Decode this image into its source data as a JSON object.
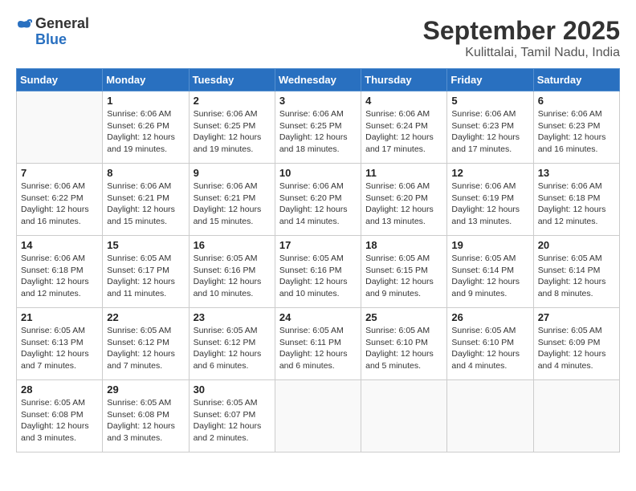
{
  "header": {
    "logo_line1": "General",
    "logo_line2": "Blue",
    "month_title": "September 2025",
    "subtitle": "Kulittalai, Tamil Nadu, India"
  },
  "days_of_week": [
    "Sunday",
    "Monday",
    "Tuesday",
    "Wednesday",
    "Thursday",
    "Friday",
    "Saturday"
  ],
  "weeks": [
    [
      {
        "day": "",
        "info": ""
      },
      {
        "day": "1",
        "info": "Sunrise: 6:06 AM\nSunset: 6:26 PM\nDaylight: 12 hours\nand 19 minutes."
      },
      {
        "day": "2",
        "info": "Sunrise: 6:06 AM\nSunset: 6:25 PM\nDaylight: 12 hours\nand 19 minutes."
      },
      {
        "day": "3",
        "info": "Sunrise: 6:06 AM\nSunset: 6:25 PM\nDaylight: 12 hours\nand 18 minutes."
      },
      {
        "day": "4",
        "info": "Sunrise: 6:06 AM\nSunset: 6:24 PM\nDaylight: 12 hours\nand 17 minutes."
      },
      {
        "day": "5",
        "info": "Sunrise: 6:06 AM\nSunset: 6:23 PM\nDaylight: 12 hours\nand 17 minutes."
      },
      {
        "day": "6",
        "info": "Sunrise: 6:06 AM\nSunset: 6:23 PM\nDaylight: 12 hours\nand 16 minutes."
      }
    ],
    [
      {
        "day": "7",
        "info": "Sunrise: 6:06 AM\nSunset: 6:22 PM\nDaylight: 12 hours\nand 16 minutes."
      },
      {
        "day": "8",
        "info": "Sunrise: 6:06 AM\nSunset: 6:21 PM\nDaylight: 12 hours\nand 15 minutes."
      },
      {
        "day": "9",
        "info": "Sunrise: 6:06 AM\nSunset: 6:21 PM\nDaylight: 12 hours\nand 15 minutes."
      },
      {
        "day": "10",
        "info": "Sunrise: 6:06 AM\nSunset: 6:20 PM\nDaylight: 12 hours\nand 14 minutes."
      },
      {
        "day": "11",
        "info": "Sunrise: 6:06 AM\nSunset: 6:20 PM\nDaylight: 12 hours\nand 13 minutes."
      },
      {
        "day": "12",
        "info": "Sunrise: 6:06 AM\nSunset: 6:19 PM\nDaylight: 12 hours\nand 13 minutes."
      },
      {
        "day": "13",
        "info": "Sunrise: 6:06 AM\nSunset: 6:18 PM\nDaylight: 12 hours\nand 12 minutes."
      }
    ],
    [
      {
        "day": "14",
        "info": "Sunrise: 6:06 AM\nSunset: 6:18 PM\nDaylight: 12 hours\nand 12 minutes."
      },
      {
        "day": "15",
        "info": "Sunrise: 6:05 AM\nSunset: 6:17 PM\nDaylight: 12 hours\nand 11 minutes."
      },
      {
        "day": "16",
        "info": "Sunrise: 6:05 AM\nSunset: 6:16 PM\nDaylight: 12 hours\nand 10 minutes."
      },
      {
        "day": "17",
        "info": "Sunrise: 6:05 AM\nSunset: 6:16 PM\nDaylight: 12 hours\nand 10 minutes."
      },
      {
        "day": "18",
        "info": "Sunrise: 6:05 AM\nSunset: 6:15 PM\nDaylight: 12 hours\nand 9 minutes."
      },
      {
        "day": "19",
        "info": "Sunrise: 6:05 AM\nSunset: 6:14 PM\nDaylight: 12 hours\nand 9 minutes."
      },
      {
        "day": "20",
        "info": "Sunrise: 6:05 AM\nSunset: 6:14 PM\nDaylight: 12 hours\nand 8 minutes."
      }
    ],
    [
      {
        "day": "21",
        "info": "Sunrise: 6:05 AM\nSunset: 6:13 PM\nDaylight: 12 hours\nand 7 minutes."
      },
      {
        "day": "22",
        "info": "Sunrise: 6:05 AM\nSunset: 6:12 PM\nDaylight: 12 hours\nand 7 minutes."
      },
      {
        "day": "23",
        "info": "Sunrise: 6:05 AM\nSunset: 6:12 PM\nDaylight: 12 hours\nand 6 minutes."
      },
      {
        "day": "24",
        "info": "Sunrise: 6:05 AM\nSunset: 6:11 PM\nDaylight: 12 hours\nand 6 minutes."
      },
      {
        "day": "25",
        "info": "Sunrise: 6:05 AM\nSunset: 6:10 PM\nDaylight: 12 hours\nand 5 minutes."
      },
      {
        "day": "26",
        "info": "Sunrise: 6:05 AM\nSunset: 6:10 PM\nDaylight: 12 hours\nand 4 minutes."
      },
      {
        "day": "27",
        "info": "Sunrise: 6:05 AM\nSunset: 6:09 PM\nDaylight: 12 hours\nand 4 minutes."
      }
    ],
    [
      {
        "day": "28",
        "info": "Sunrise: 6:05 AM\nSunset: 6:08 PM\nDaylight: 12 hours\nand 3 minutes."
      },
      {
        "day": "29",
        "info": "Sunrise: 6:05 AM\nSunset: 6:08 PM\nDaylight: 12 hours\nand 3 minutes."
      },
      {
        "day": "30",
        "info": "Sunrise: 6:05 AM\nSunset: 6:07 PM\nDaylight: 12 hours\nand 2 minutes."
      },
      {
        "day": "",
        "info": ""
      },
      {
        "day": "",
        "info": ""
      },
      {
        "day": "",
        "info": ""
      },
      {
        "day": "",
        "info": ""
      }
    ]
  ]
}
